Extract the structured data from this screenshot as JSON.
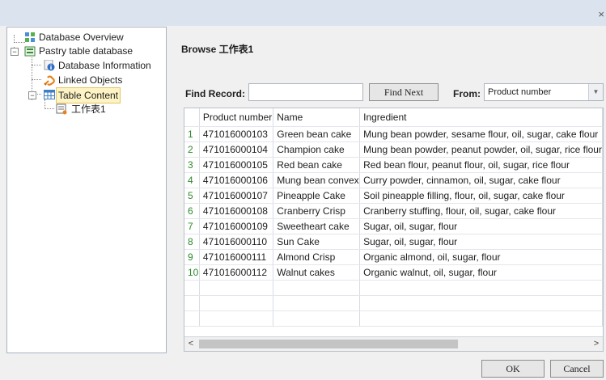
{
  "window": {
    "close_glyph": "×"
  },
  "tree": {
    "items": [
      {
        "label": "Database Overview",
        "icon": "database-overview-icon"
      },
      {
        "label": "Pastry table database",
        "icon": "database-icon"
      },
      {
        "label": "Database Information",
        "icon": "info-icon"
      },
      {
        "label": "Linked Objects",
        "icon": "link-icon"
      },
      {
        "label": "Table Content",
        "icon": "table-icon",
        "selected": true
      },
      {
        "label": "工作表1",
        "icon": "sheet-icon"
      }
    ]
  },
  "browse": {
    "title": "Browse 工作表1"
  },
  "find": {
    "label": "Find Record:",
    "value": "",
    "button": "Find Next",
    "from_label": "From:",
    "from_value": "Product number"
  },
  "table": {
    "columns": [
      "Product number",
      "Name",
      "Ingredient"
    ],
    "rows": [
      {
        "n": "1",
        "product": "471016000103",
        "name": "Green bean cake",
        "ingredient": "Mung bean powder, sesame flour, oil, sugar, cake flour"
      },
      {
        "n": "2",
        "product": "471016000104",
        "name": "Champion cake",
        "ingredient": "Mung bean powder, peanut powder, oil, sugar, rice flour"
      },
      {
        "n": "3",
        "product": "471016000105",
        "name": "Red bean cake",
        "ingredient": "Red bean flour, peanut flour, oil, sugar, rice flour"
      },
      {
        "n": "4",
        "product": "471016000106",
        "name": "Mung bean convex",
        "ingredient": "Curry powder, cinnamon, oil, sugar, cake flour"
      },
      {
        "n": "5",
        "product": "471016000107",
        "name": "Pineapple Cake",
        "ingredient": "Soil pineapple filling, flour, oil, sugar, cake flour"
      },
      {
        "n": "6",
        "product": "471016000108",
        "name": "Cranberry Crisp",
        "ingredient": "Cranberry stuffing, flour, oil, sugar, cake flour"
      },
      {
        "n": "7",
        "product": "471016000109",
        "name": "Sweetheart cake",
        "ingredient": "Sugar, oil, sugar, flour"
      },
      {
        "n": "8",
        "product": "471016000110",
        "name": "Sun Cake",
        "ingredient": "Sugar, oil, sugar, flour"
      },
      {
        "n": "9",
        "product": "471016000111",
        "name": "Almond Crisp",
        "ingredient": "Organic almond, oil, sugar, flour"
      },
      {
        "n": "10",
        "product": "471016000112",
        "name": "Walnut cakes",
        "ingredient": "Organic walnut, oil, sugar, flour"
      }
    ],
    "empty_rows": 3
  },
  "scroll": {
    "left": "<",
    "right": ">"
  },
  "buttons": {
    "ok": "OK",
    "cancel": "Cancel"
  },
  "colors": {
    "row_number": "#2e8a2e",
    "selection_fill": "#fdf3c4",
    "title_bar": "#dbe3ee"
  }
}
